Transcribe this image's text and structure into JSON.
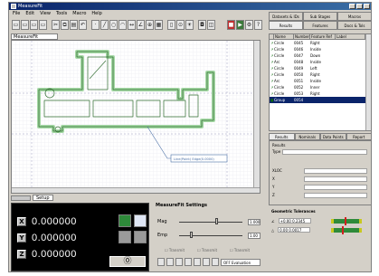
{
  "window": {
    "title": "MeasureFit"
  },
  "menu": [
    "File",
    "Edit",
    "View",
    "Tools",
    "Macro",
    "Help"
  ],
  "doc_tab": "MeasureFit",
  "canvas": {
    "callout_label": "Line(Point) Edge(0.0000)",
    "colors": {
      "part_outline": "#4caf50",
      "grid": "#c8c8d8",
      "callout": "#4a6fa5"
    }
  },
  "bottom_tabs": [
    "Setup"
  ],
  "dro": {
    "rows": [
      {
        "axis": "X",
        "value": "0.000000"
      },
      {
        "axis": "Y",
        "value": "0.000000"
      },
      {
        "axis": "Z",
        "value": "0.000000"
      }
    ],
    "button_row": "⓪"
  },
  "measure_settings": {
    "title": "MeasureFit Settings",
    "mag_label": "Mag",
    "mag_value": "1.000",
    "mag_level": 0.6,
    "emp_label": "Emp",
    "emp_value": "1.00",
    "emp_level": 0.2,
    "checks": [
      "Transmit",
      "Transmit",
      "Transmit"
    ],
    "mode_select": "OFF Evaluation"
  },
  "right_tabs": [
    "Datasets & IDs",
    "Sub Stages",
    "Macros",
    "Results",
    "Features",
    "Docs & Tols"
  ],
  "feature_list": {
    "headers": [
      "",
      "Name",
      "Number",
      "Feature Ref",
      "Label"
    ],
    "rows": [
      {
        "name": "Circle",
        "num": "0045",
        "ref": "Right",
        "sel": false
      },
      {
        "name": "Circle",
        "num": "0046",
        "ref": "Inside",
        "sel": false
      },
      {
        "name": "Circle",
        "num": "0047",
        "ref": "Down",
        "sel": false
      },
      {
        "name": "Arc",
        "num": "0048",
        "ref": "Inside",
        "sel": false
      },
      {
        "name": "Circle",
        "num": "0049",
        "ref": "Left",
        "sel": false
      },
      {
        "name": "Circle",
        "num": "0050",
        "ref": "Right",
        "sel": false
      },
      {
        "name": "Arc",
        "num": "0051",
        "ref": "Inside",
        "sel": false
      },
      {
        "name": "Circle",
        "num": "0052",
        "ref": "Inner",
        "sel": false
      },
      {
        "name": "Circle",
        "num": "0053",
        "ref": "Right",
        "sel": false
      },
      {
        "name": "Group",
        "num": "0054",
        "ref": "",
        "sel": true
      }
    ]
  },
  "results_tabs": [
    "Results",
    "Nominals",
    "Data Points",
    "Report"
  ],
  "results": {
    "sub": "Results",
    "type_label": "Type",
    "fields": [
      "XLOC",
      "X",
      "Y",
      "Z"
    ]
  },
  "geo_tol": {
    "title": "Geometric Tolerances",
    "rows": [
      {
        "icon": "∠",
        "value": "+0.00 0.2345"
      },
      {
        "icon": "△",
        "value": "0.00 0.0017"
      }
    ]
  }
}
